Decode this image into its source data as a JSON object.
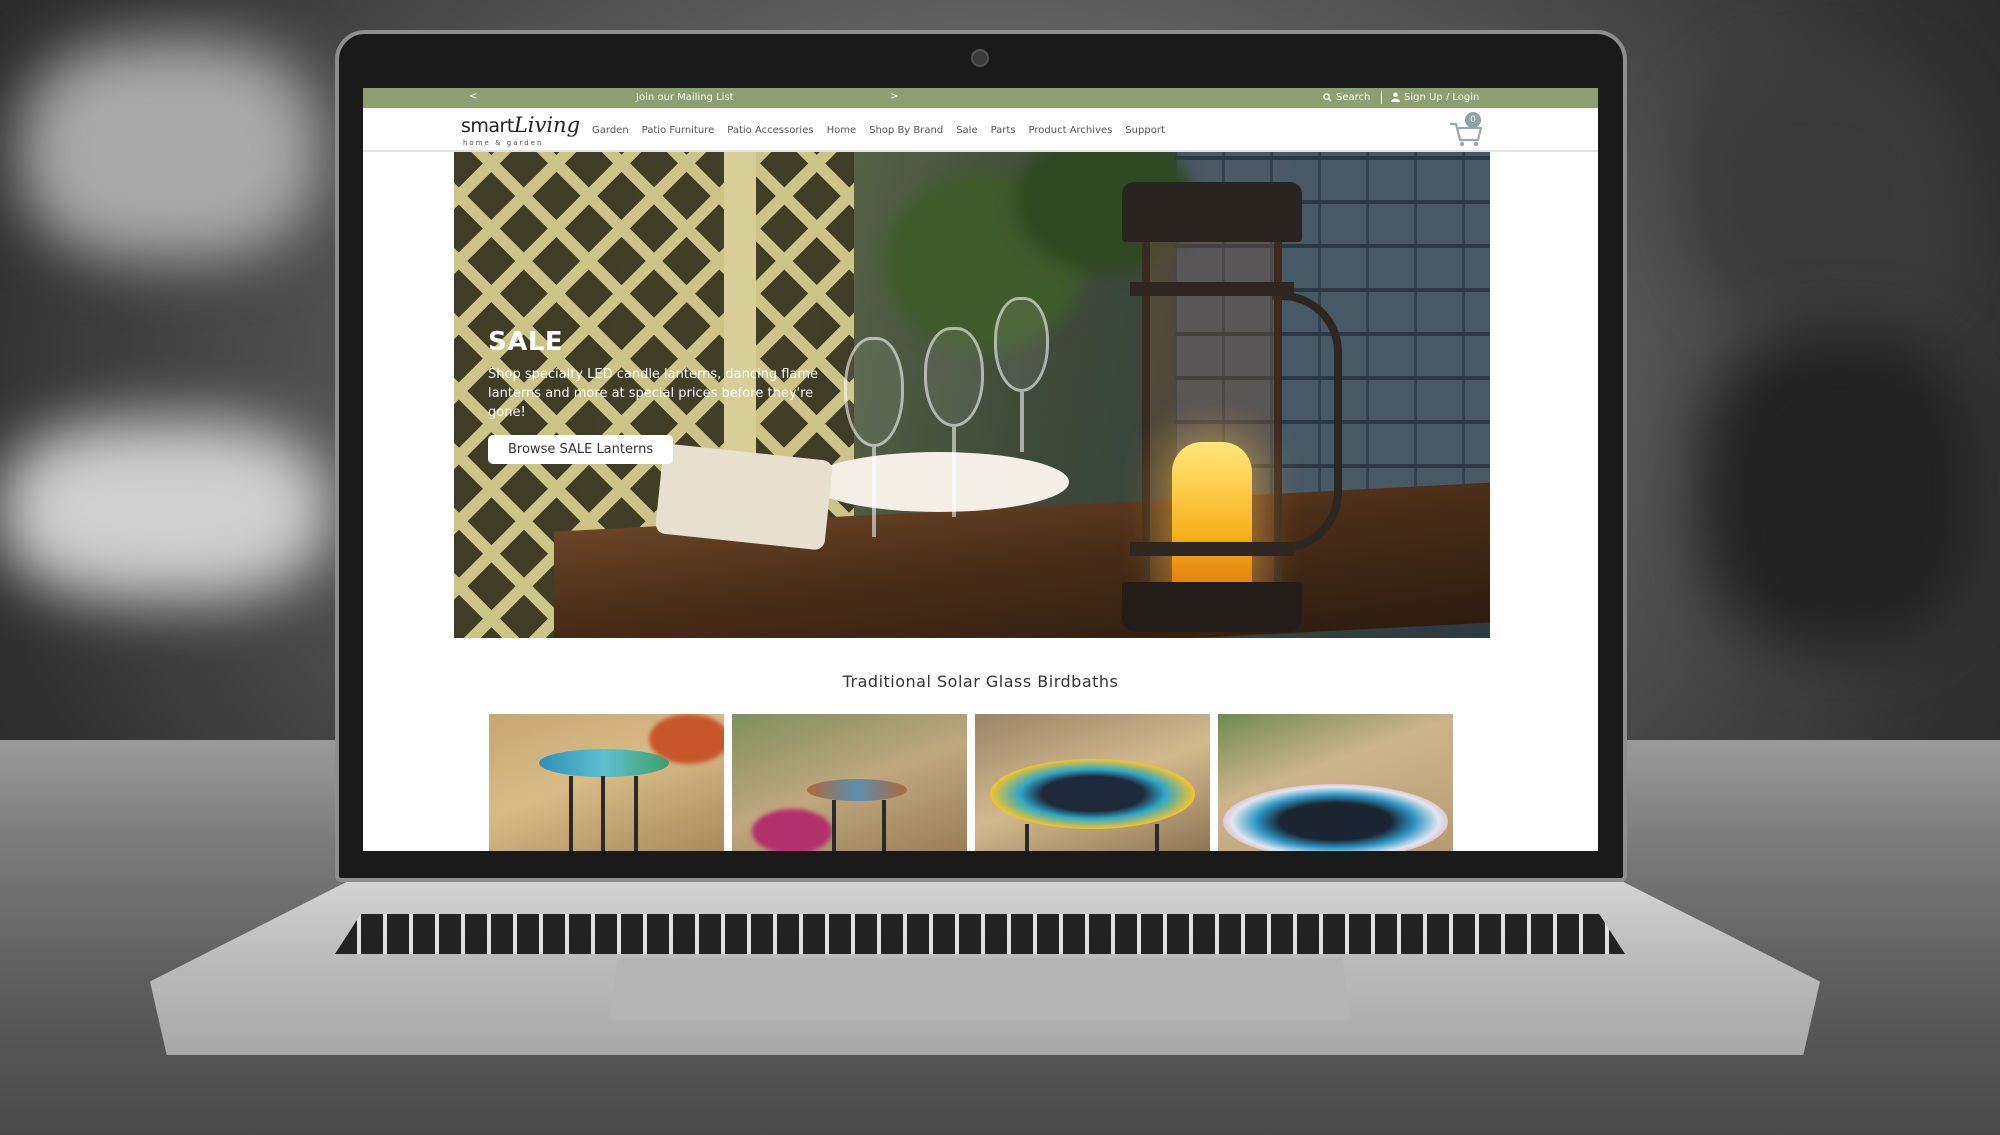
{
  "topbar": {
    "prev_arrow": "<",
    "mailing_list": "Join our Mailing List",
    "next_arrow": ">",
    "search": "Search",
    "signup_login": "Sign Up / Login"
  },
  "logo": {
    "word": "smart",
    "script": "Living",
    "tagline": "home & garden"
  },
  "nav": {
    "items": [
      {
        "label": "Garden"
      },
      {
        "label": "Patio Furniture"
      },
      {
        "label": "Patio Accessories"
      },
      {
        "label": "Home"
      },
      {
        "label": "Shop By Brand"
      },
      {
        "label": "Sale"
      },
      {
        "label": "Parts"
      },
      {
        "label": "Product Archives"
      },
      {
        "label": "Support"
      }
    ]
  },
  "cart": {
    "count": "0"
  },
  "hero": {
    "title": "SALE",
    "description": "Shop specialty LED candle lanterns, dancing flame lanterns and more at special prices before they're gone!",
    "button_label": "Browse SALE Lanterns"
  },
  "section": {
    "title": "Traditional Solar Glass Birdbaths"
  },
  "colors": {
    "topbar_green": "#8d9f70",
    "cart_badge": "#8fa1a8"
  }
}
